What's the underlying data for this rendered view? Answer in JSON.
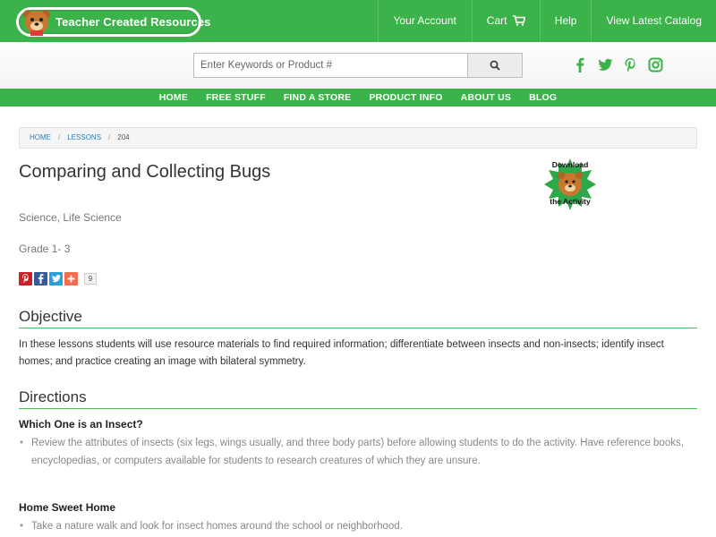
{
  "header": {
    "logo_text": "Teacher Created Resources",
    "nav": [
      {
        "label": "Your Account"
      },
      {
        "label": "Cart"
      },
      {
        "label": "Help"
      },
      {
        "label": "View Latest Catalog"
      }
    ]
  },
  "search": {
    "placeholder": "Enter Keywords or Product #"
  },
  "social": [
    "facebook-icon",
    "twitter-icon",
    "pinterest-icon",
    "instagram-icon"
  ],
  "main_nav": [
    "HOME",
    "FREE STUFF",
    "FIND A STORE",
    "PRODUCT INFO",
    "ABOUT US",
    "BLOG"
  ],
  "breadcrumb": [
    "HOME",
    "LESSONS",
    "204"
  ],
  "lesson": {
    "title": "Comparing and Collecting Bugs",
    "subject": "Science, Life Science",
    "grade": "Grade 1- 3",
    "share_count": "9",
    "badge_top": "Download",
    "badge_bottom": "the Activity"
  },
  "objective": {
    "heading": "Objective",
    "text": "In these lessons students will use resource materials to find required information; differentiate between insects and non-insects; identify insect homes; and practice creating an image with bilateral symmetry."
  },
  "directions": {
    "heading": "Directions",
    "items": [
      {
        "title": "Which One is an Insect?",
        "bullet": "Review the attributes of insects (six legs, wings usually, and three body parts) before allowing students to do the activity. Have reference books, encyclopedias, or computers available for students to research creatures of which they are unsure."
      },
      {
        "title": "Home Sweet Home",
        "bullet": "Take a nature walk and look for insect homes around the school or neighborhood."
      }
    ]
  },
  "colors": {
    "brand_green": "#3bb34a",
    "link_blue": "#2a7fb8"
  }
}
